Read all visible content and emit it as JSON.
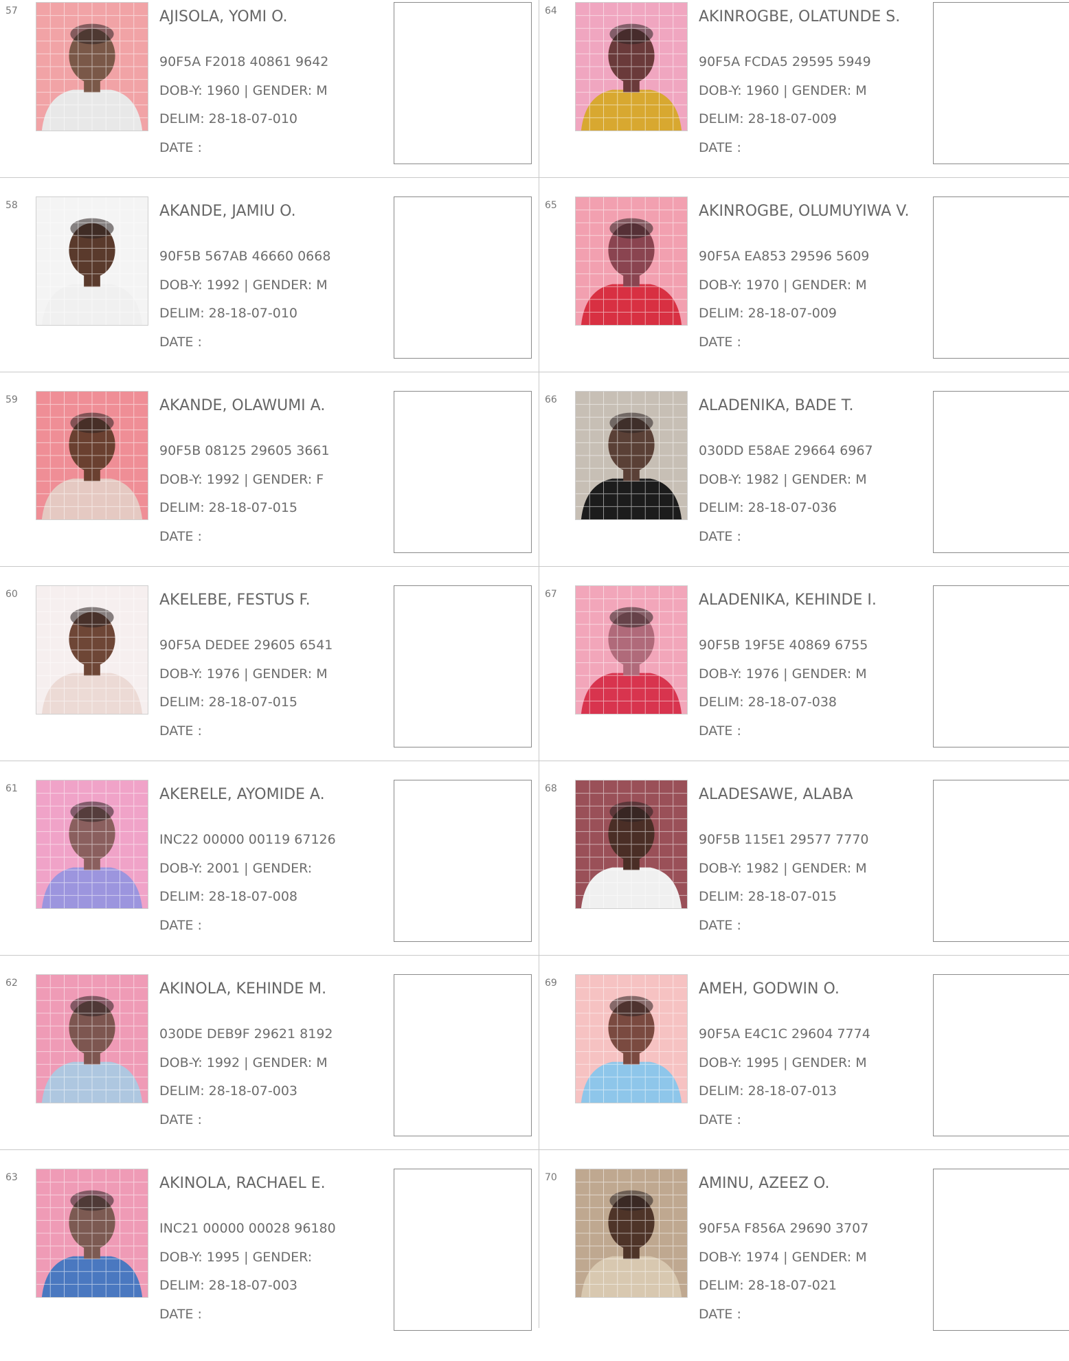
{
  "labels": {
    "dob": "DOB-Y:",
    "gender": "| GENDER:",
    "delim": "DELIM:",
    "date": "DATE  :"
  },
  "entries": [
    {
      "serial": "57",
      "name": "AJISOLA, YOMI O.",
      "vin": "90F5A F2018 40861 9642",
      "dob_year": "1960",
      "gender": "M",
      "delim": "28-18-07-010",
      "photo": {
        "bg": "#f1a3a6",
        "shirt": "#e8e8e8",
        "skin": "#7a5848"
      }
    },
    {
      "serial": "58",
      "name": "AKANDE, JAMIU O.",
      "vin": "90F5B 567AB 46660 0668",
      "dob_year": "1992",
      "gender": "M",
      "delim": "28-18-07-010",
      "photo": {
        "bg": "#f4f4f4",
        "shirt": "#f0f0f0",
        "skin": "#5a3a2c"
      }
    },
    {
      "serial": "59",
      "name": "AKANDE, OLAWUMI A.",
      "vin": "90F5B 08125 29605 3661",
      "dob_year": "1992",
      "gender": "F",
      "delim": "28-18-07-015",
      "photo": {
        "bg": "#ef8e96",
        "shirt": "#e5c9c2",
        "skin": "#6a4030"
      }
    },
    {
      "serial": "60",
      "name": "AKELEBE, FESTUS F.",
      "vin": "90F5A DEDEE 29605 6541",
      "dob_year": "1976",
      "gender": "M",
      "delim": "28-18-07-015",
      "photo": {
        "bg": "#f6efef",
        "shirt": "#ecdad5",
        "skin": "#6e4636"
      }
    },
    {
      "serial": "61",
      "name": "AKERELE, AYOMIDE A.",
      "vin": "INC22 00000 00119 67126",
      "dob_year": "2001",
      "gender": "",
      "delim": "28-18-07-008",
      "photo": {
        "bg": "#f0a3c8",
        "shirt": "#9c95de",
        "skin": "#8a5f5e"
      }
    },
    {
      "serial": "62",
      "name": "AKINOLA, KEHINDE M.",
      "vin": "030DE DEB9F 29621 8192",
      "dob_year": "1992",
      "gender": "M",
      "delim": "28-18-07-003",
      "photo": {
        "bg": "#ef9bb6",
        "shirt": "#aec7e0",
        "skin": "#7d5650"
      }
    },
    {
      "serial": "63",
      "name": "AKINOLA, RACHAEL E.",
      "vin": "INC21 00000 00028 96180",
      "dob_year": "1995",
      "gender": "",
      "delim": "28-18-07-003",
      "photo": {
        "bg": "#ef9bb6",
        "shirt": "#4a78c0",
        "skin": "#7c5a52"
      }
    },
    {
      "serial": "64",
      "name": "AKINROGBE, OLATUNDE S.",
      "vin": "90F5A FCDA5 29595 5949",
      "dob_year": "1960",
      "gender": "M",
      "delim": "28-18-07-009",
      "photo": {
        "bg": "#f0a6c0",
        "shirt": "#d8a830",
        "skin": "#6a3a3a"
      }
    },
    {
      "serial": "65",
      "name": "AKINROGBE, OLUMUYIWA V.",
      "vin": "90F5A EA853 29596 5609",
      "dob_year": "1970",
      "gender": "M",
      "delim": "28-18-07-009",
      "photo": {
        "bg": "#f2a0b0",
        "shirt": "#d83042",
        "skin": "#8a4450"
      }
    },
    {
      "serial": "66",
      "name": "ALADENIKA, BADE T.",
      "vin": "030DD E58AE 29664 6967",
      "dob_year": "1982",
      "gender": "M",
      "delim": "28-18-07-036",
      "photo": {
        "bg": "#c7bfb5",
        "shirt": "#1c1c1c",
        "skin": "#5a4036"
      }
    },
    {
      "serial": "67",
      "name": "ALADENIKA, KEHINDE I.",
      "vin": "90F5B 19F5E 40869 6755",
      "dob_year": "1976",
      "gender": "M",
      "delim": "28-18-07-038",
      "photo": {
        "bg": "#f2a6ba",
        "shirt": "#d8344e",
        "skin": "#b06a7a"
      }
    },
    {
      "serial": "68",
      "name": "ALADESAWE, ALABA",
      "vin": "90F5B 115E1 29577 7770",
      "dob_year": "1982",
      "gender": "M",
      "delim": "28-18-07-015",
      "photo": {
        "bg": "#9a5058",
        "shirt": "#f0f0f0",
        "skin": "#4a2e26"
      }
    },
    {
      "serial": "69",
      "name": "AMEH, GODWIN O.",
      "vin": "90F5A E4C1C 29604 7774",
      "dob_year": "1995",
      "gender": "M",
      "delim": "28-18-07-013",
      "photo": {
        "bg": "#f6c2c2",
        "shirt": "#8ec6ea",
        "skin": "#7a4a40"
      }
    },
    {
      "serial": "70",
      "name": "AMINU, AZEEZ O.",
      "vin": "90F5A F856A 29690 3707",
      "dob_year": "1974",
      "gender": "M",
      "delim": "28-18-07-021",
      "photo": {
        "bg": "#bfa890",
        "shirt": "#d8c8b0",
        "skin": "#4e3428"
      }
    }
  ]
}
